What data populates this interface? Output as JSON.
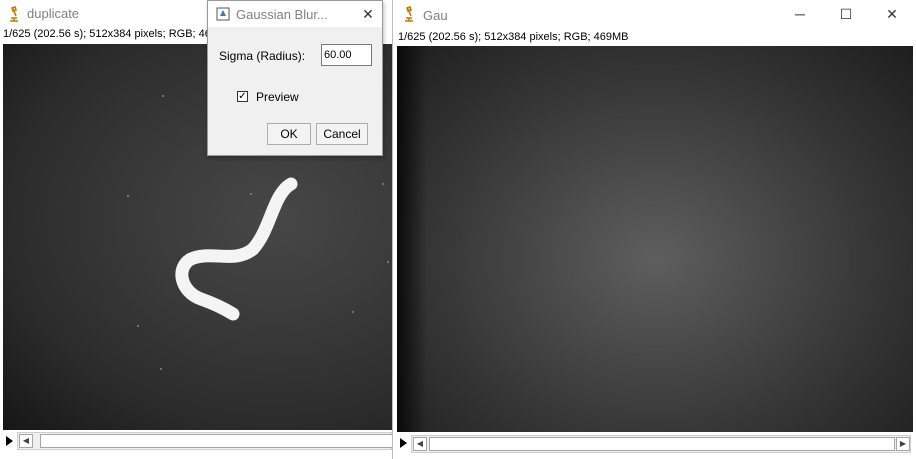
{
  "left_window": {
    "title": "duplicate",
    "info": "1/625 (202.56 s); 512x384 pixels; RGB; 469MB"
  },
  "right_window": {
    "title": "Gau",
    "info": "1/625 (202.56 s); 512x384 pixels; RGB; 469MB",
    "controls": {
      "minimize": "─",
      "maximize": "☐",
      "close": "✕"
    }
  },
  "dialog": {
    "title": "Gaussian Blur...",
    "sigma_label": "Sigma (Radius):",
    "sigma_value": "60.00",
    "preview_label": "Preview",
    "preview_checked": "✓",
    "close": "✕",
    "ok_label": "OK",
    "cancel_label": "Cancel"
  },
  "scrollbar": {
    "left_arrow": "◀",
    "right_arrow": "▶"
  }
}
